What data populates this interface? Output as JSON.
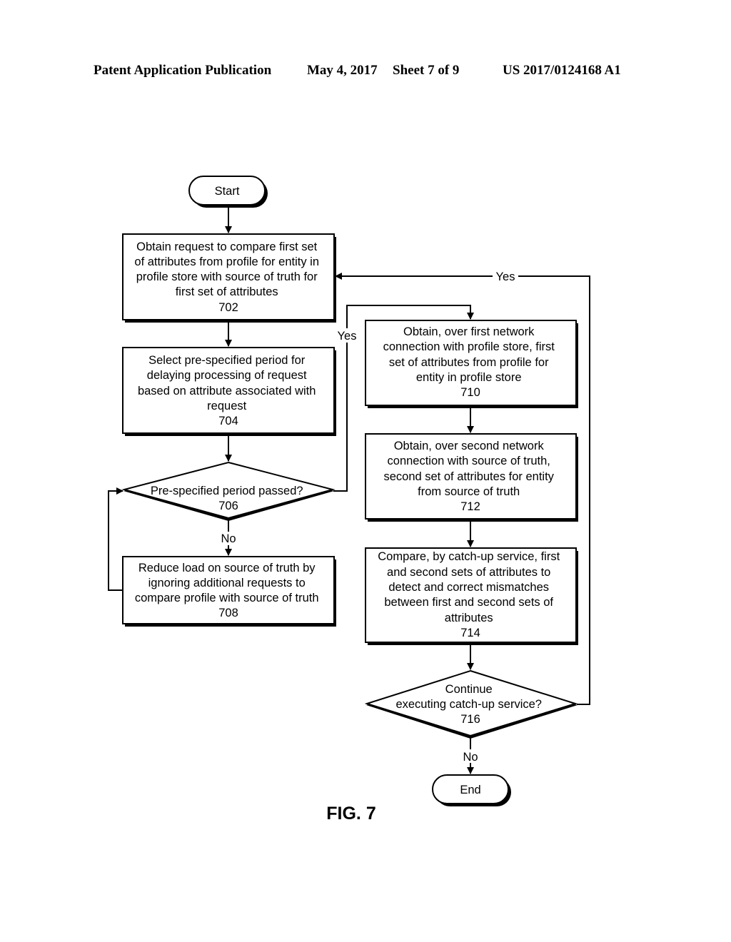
{
  "header": {
    "publication": "Patent Application Publication",
    "date": "May 4, 2017",
    "sheet": "Sheet 7 of 9",
    "number": "US 2017/0124168 A1"
  },
  "figure_label": "FIG. 7",
  "nodes": {
    "start": {
      "type": "terminal",
      "label": "Start"
    },
    "n702": {
      "type": "process",
      "lines": [
        "Obtain request to compare first set",
        "of attributes from profile for entity in",
        "profile store with source of truth for",
        "first set of attributes"
      ],
      "ref": "702"
    },
    "n704": {
      "type": "process",
      "lines": [
        "Select pre-specified period for",
        "delaying processing of request",
        "based on attribute associated with",
        "request"
      ],
      "ref": "704"
    },
    "n706": {
      "type": "decision",
      "lines": [
        "Pre-specified period passed?"
      ],
      "ref": "706"
    },
    "n708": {
      "type": "process",
      "lines": [
        "Reduce load on source of truth by",
        "ignoring additional requests to",
        "compare profile with source of truth"
      ],
      "ref": "708"
    },
    "n710": {
      "type": "process",
      "lines": [
        "Obtain, over first network",
        "connection with profile store, first",
        "set of attributes from profile for",
        "entity in profile store"
      ],
      "ref": "710"
    },
    "n712": {
      "type": "process",
      "lines": [
        "Obtain, over second network",
        "connection with source of truth,",
        "second set of attributes for entity",
        "from source of truth"
      ],
      "ref": "712"
    },
    "n714": {
      "type": "process",
      "lines": [
        "Compare, by catch-up service, first",
        "and second sets of attributes to",
        "detect and correct mismatches",
        "between first and second sets of",
        "attributes"
      ],
      "ref": "714"
    },
    "n716": {
      "type": "decision",
      "lines": [
        "Continue",
        "executing catch-up service?"
      ],
      "ref": "716"
    },
    "end": {
      "type": "terminal",
      "label": "End"
    }
  },
  "edges": [
    {
      "from": "start",
      "to": "n702",
      "label": ""
    },
    {
      "from": "n702",
      "to": "n704",
      "label": ""
    },
    {
      "from": "n704",
      "to": "n706",
      "label": ""
    },
    {
      "from": "n706",
      "to": "n708",
      "label": "No"
    },
    {
      "from": "n706",
      "to": "n710",
      "label": "Yes"
    },
    {
      "from": "n708",
      "to": "n706",
      "label": ""
    },
    {
      "from": "n710",
      "to": "n712",
      "label": ""
    },
    {
      "from": "n712",
      "to": "n714",
      "label": ""
    },
    {
      "from": "n714",
      "to": "n716",
      "label": ""
    },
    {
      "from": "n716",
      "to": "n702",
      "label": "Yes"
    },
    {
      "from": "n716",
      "to": "end",
      "label": "No"
    }
  ]
}
